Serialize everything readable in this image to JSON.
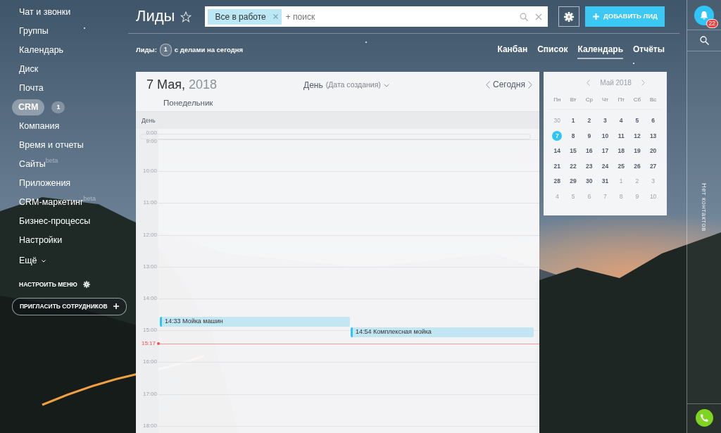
{
  "sidebar": {
    "items": [
      {
        "label": "Чат и звонки",
        "selected": false,
        "kind": "link"
      },
      {
        "label": "Группы",
        "selected": false,
        "kind": "link"
      },
      {
        "label": "Календарь",
        "selected": false,
        "kind": "link"
      },
      {
        "label": "Диск",
        "selected": false,
        "kind": "link"
      },
      {
        "label": "Почта",
        "selected": false,
        "kind": "link"
      },
      {
        "label": "CRM",
        "selected": true,
        "kind": "link",
        "counter": "1"
      },
      {
        "label": "Компания",
        "selected": false,
        "kind": "link"
      },
      {
        "label": "Время и отчеты",
        "selected": false,
        "kind": "link"
      },
      {
        "label": "Сайты",
        "selected": false,
        "kind": "link",
        "tag": "beta"
      },
      {
        "label": "Приложения",
        "selected": false,
        "kind": "link"
      },
      {
        "label": "CRM-маркетинг",
        "selected": false,
        "kind": "link",
        "tag": "beta"
      },
      {
        "label": "Бизнес-процессы",
        "selected": false,
        "kind": "link"
      },
      {
        "label": "Настройки",
        "selected": false,
        "kind": "link"
      },
      {
        "label": "Ещё",
        "selected": false,
        "kind": "more"
      }
    ],
    "configure": "НАСТРОИТЬ МЕНЮ",
    "invite": "ПРИГЛАСИТЬ СОТРУДНИКОВ"
  },
  "header": {
    "title": "Лиды",
    "filter": {
      "chip": "Все в работе",
      "placeholder": "+ поиск"
    },
    "add_button": "ДОБАВИТЬ ЛИД"
  },
  "counter_line": {
    "label": "Лиды:",
    "count": "1",
    "text": "с делами на сегодня"
  },
  "views": [
    {
      "label": "Канбан",
      "selected": false
    },
    {
      "label": "Список",
      "selected": false
    },
    {
      "label": "Календарь",
      "selected": true
    },
    {
      "label": "Отчёты",
      "selected": false
    }
  ],
  "calendar": {
    "date": "7 Мая,",
    "year": "2018",
    "weekday": "Понедельник",
    "mode": "День",
    "mode_hint": "(Дата создания)",
    "today": "Сегодня",
    "column_header": "День",
    "hours": [
      {
        "label": "0:00",
        "kind": "collapsed"
      },
      {
        "label": "9:00",
        "kind": "hour"
      },
      {
        "label": "10:00",
        "kind": "hour"
      },
      {
        "label": "11:00",
        "kind": "hour"
      },
      {
        "label": "12:00",
        "kind": "hour"
      },
      {
        "label": "13:00",
        "kind": "hour"
      },
      {
        "label": "14:00",
        "kind": "hour",
        "events": [
          {
            "time": "14:33",
            "title": "Мойка машин"
          },
          {
            "time": "14:54",
            "title": "Комплексная мойка"
          }
        ]
      },
      {
        "label": "15:00",
        "kind": "hour",
        "now": "15:17"
      },
      {
        "label": "16:00",
        "kind": "hour"
      },
      {
        "label": "17:00",
        "kind": "hour"
      },
      {
        "label": "18:00",
        "kind": "hour"
      }
    ]
  },
  "mini_calendar": {
    "month": "Май 2018",
    "weekdays": [
      "Пн",
      "Вт",
      "Ср",
      "Чт",
      "Пт",
      "Сб",
      "Вс"
    ],
    "weeks": [
      [
        {
          "day": "30",
          "muted": true,
          "selected": false
        },
        {
          "day": "1",
          "muted": false,
          "selected": false
        },
        {
          "day": "2",
          "muted": false,
          "selected": false
        },
        {
          "day": "3",
          "muted": false,
          "selected": false
        },
        {
          "day": "4",
          "muted": false,
          "selected": false
        },
        {
          "day": "5",
          "muted": false,
          "selected": false
        },
        {
          "day": "6",
          "muted": false,
          "selected": false
        }
      ],
      [
        {
          "day": "7",
          "muted": false,
          "selected": true
        },
        {
          "day": "8",
          "muted": false,
          "selected": false
        },
        {
          "day": "9",
          "muted": false,
          "selected": false
        },
        {
          "day": "10",
          "muted": false,
          "selected": false
        },
        {
          "day": "11",
          "muted": false,
          "selected": false
        },
        {
          "day": "12",
          "muted": false,
          "selected": false
        },
        {
          "day": "13",
          "muted": false,
          "selected": false
        }
      ],
      [
        {
          "day": "14",
          "muted": false,
          "selected": false
        },
        {
          "day": "15",
          "muted": false,
          "selected": false
        },
        {
          "day": "16",
          "muted": false,
          "selected": false
        },
        {
          "day": "17",
          "muted": false,
          "selected": false
        },
        {
          "day": "18",
          "muted": false,
          "selected": false
        },
        {
          "day": "19",
          "muted": false,
          "selected": false
        },
        {
          "day": "20",
          "muted": false,
          "selected": false
        }
      ],
      [
        {
          "day": "21",
          "muted": false,
          "selected": false
        },
        {
          "day": "22",
          "muted": false,
          "selected": false
        },
        {
          "day": "23",
          "muted": false,
          "selected": false
        },
        {
          "day": "24",
          "muted": false,
          "selected": false
        },
        {
          "day": "25",
          "muted": false,
          "selected": false
        },
        {
          "day": "26",
          "muted": false,
          "selected": false
        },
        {
          "day": "27",
          "muted": false,
          "selected": false
        }
      ],
      [
        {
          "day": "28",
          "muted": false,
          "selected": false
        },
        {
          "day": "29",
          "muted": false,
          "selected": false
        },
        {
          "day": "30",
          "muted": false,
          "selected": false
        },
        {
          "day": "31",
          "muted": false,
          "selected": false
        },
        {
          "day": "1",
          "muted": true,
          "selected": false
        },
        {
          "day": "2",
          "muted": true,
          "selected": false
        },
        {
          "day": "3",
          "muted": true,
          "selected": false
        }
      ],
      [
        {
          "day": "4",
          "muted": true,
          "selected": false
        },
        {
          "day": "5",
          "muted": true,
          "selected": false
        },
        {
          "day": "6",
          "muted": true,
          "selected": false
        },
        {
          "day": "7",
          "muted": true,
          "selected": false
        },
        {
          "day": "8",
          "muted": true,
          "selected": false
        },
        {
          "day": "9",
          "muted": true,
          "selected": false
        },
        {
          "day": "10",
          "muted": true,
          "selected": false
        }
      ]
    ]
  },
  "right_panel": {
    "notifications": "22",
    "contacts": "Нет контактов"
  }
}
